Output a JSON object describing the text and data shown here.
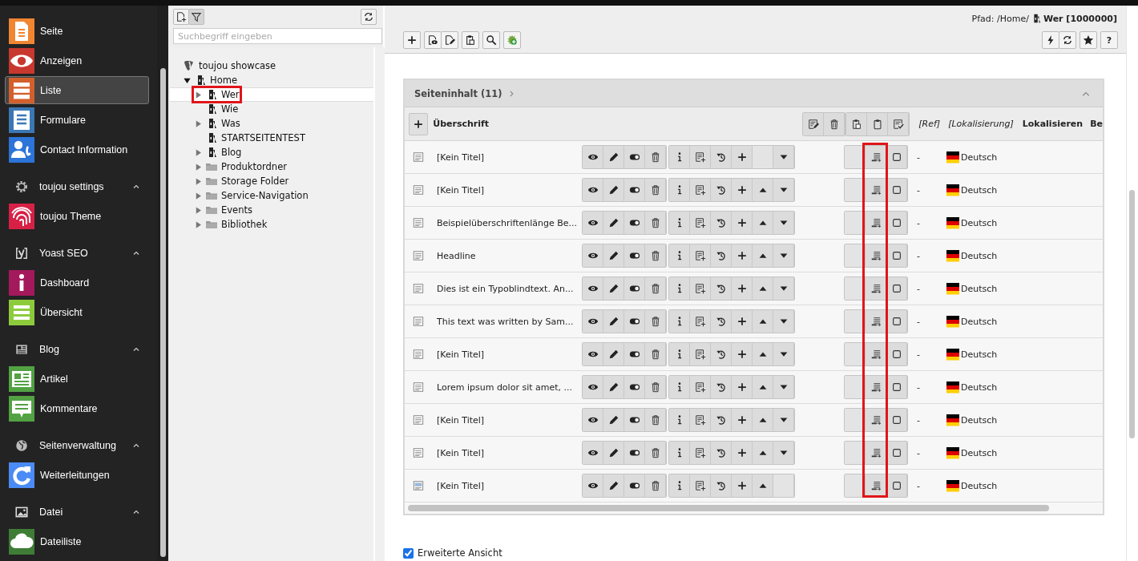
{
  "sidebar": {
    "items": [
      {
        "kind": "module",
        "label": "Seite",
        "color": "#f08532",
        "selected": false
      },
      {
        "kind": "module",
        "label": "Anzeigen",
        "color": "#c8382e",
        "selected": false
      },
      {
        "kind": "module",
        "label": "Liste",
        "color": "#d3602c",
        "selected": true
      },
      {
        "kind": "module",
        "label": "Formulare",
        "color": "#3b77b5",
        "selected": false
      },
      {
        "kind": "module",
        "label": "Contact Information",
        "color": "#2c74d8",
        "selected": false
      },
      {
        "kind": "group",
        "label": "toujou settings",
        "expanded": true
      },
      {
        "kind": "module",
        "label": "toujou Theme",
        "color": "#d72046",
        "selected": false
      },
      {
        "kind": "group",
        "label": "Yoast SEO",
        "expanded": true
      },
      {
        "kind": "module",
        "label": "Dashboard",
        "color": "#a4195c",
        "selected": false
      },
      {
        "kind": "module",
        "label": "Übersicht",
        "color": "#8dcb3d",
        "selected": false
      },
      {
        "kind": "group",
        "label": "Blog",
        "expanded": true
      },
      {
        "kind": "module",
        "label": "Artikel",
        "color": "#52a243",
        "selected": false
      },
      {
        "kind": "module",
        "label": "Kommentare",
        "color": "#52a243",
        "selected": false
      },
      {
        "kind": "group",
        "label": "Seitenverwaltung",
        "expanded": true
      },
      {
        "kind": "module",
        "label": "Weiterleitungen",
        "color": "#4a8bf5",
        "selected": false
      },
      {
        "kind": "group",
        "label": "Datei",
        "expanded": true
      },
      {
        "kind": "module",
        "label": "Dateiliste",
        "color": "#3f7d36",
        "selected": false
      }
    ]
  },
  "page_tree": {
    "filter_active": true,
    "search": {
      "placeholder": "Suchbegriff eingeben"
    },
    "nodes": [
      {
        "label": "toujou showcase",
        "kind": "root",
        "has_children": false,
        "selected": false,
        "highlighted": false,
        "children": [
          {
            "label": "Home",
            "kind": "page",
            "has_children": true,
            "expanded": true,
            "selected": false,
            "highlighted": false,
            "children": [
              {
                "label": "Wer",
                "kind": "page",
                "has_children": true,
                "expanded": false,
                "selected": true,
                "highlighted": true
              },
              {
                "label": "Wie",
                "kind": "page",
                "has_children": false,
                "selected": false,
                "highlighted": false
              },
              {
                "label": "Was",
                "kind": "page",
                "has_children": true,
                "expanded": false,
                "selected": false,
                "highlighted": false
              },
              {
                "label": "STARTSEITENTEST",
                "kind": "page",
                "has_children": false,
                "selected": false,
                "highlighted": false
              },
              {
                "label": "Blog",
                "kind": "page",
                "has_children": true,
                "expanded": false,
                "selected": false,
                "highlighted": false
              },
              {
                "label": "Produktordner",
                "kind": "folder",
                "has_children": true,
                "expanded": false,
                "selected": false,
                "highlighted": false
              },
              {
                "label": "Storage Folder",
                "kind": "folder",
                "has_children": true,
                "expanded": false,
                "selected": false,
                "highlighted": false
              },
              {
                "label": "Service-Navigation",
                "kind": "folder",
                "has_children": true,
                "expanded": false,
                "selected": false,
                "highlighted": false
              },
              {
                "label": "Events",
                "kind": "folder",
                "has_children": true,
                "expanded": false,
                "selected": false,
                "highlighted": false
              },
              {
                "label": "Bibliothek",
                "kind": "folder",
                "has_children": true,
                "expanded": false,
                "selected": false,
                "highlighted": false
              }
            ]
          }
        ]
      }
    ]
  },
  "docheader": {
    "path_prefix": "Pfad: /Home/",
    "path_page": "Wer [1000000]",
    "help_label": "?"
  },
  "panel": {
    "title": "Seiteninhalt (11)",
    "expanded": true,
    "column_highlight": true,
    "columns": [
      {
        "label": "Überschrift",
        "kind": "heading"
      },
      {
        "label": "[Ref]",
        "kind": "note"
      },
      {
        "label": "[Lokalisierung]",
        "kind": "note"
      },
      {
        "label": "Lokalisieren",
        "kind": "heading"
      },
      {
        "label": "Be",
        "kind": "heading"
      }
    ],
    "rows": [
      {
        "kind": "text",
        "title": "[Kein Titel]",
        "move_up": false,
        "move_down": true,
        "checked": false,
        "ref": "-",
        "language": "Deutsch"
      },
      {
        "kind": "text",
        "title": "[Kein Titel]",
        "move_up": true,
        "move_down": true,
        "checked": false,
        "ref": "-",
        "language": "Deutsch"
      },
      {
        "kind": "text",
        "title": "Beispielüberschriftenlänge Be...",
        "move_up": true,
        "move_down": true,
        "checked": false,
        "ref": "-",
        "language": "Deutsch"
      },
      {
        "kind": "text",
        "title": "Headline",
        "move_up": true,
        "move_down": true,
        "checked": false,
        "ref": "-",
        "language": "Deutsch"
      },
      {
        "kind": "text",
        "title": "Dies ist ein Typoblindtext. An...",
        "move_up": true,
        "move_down": true,
        "checked": false,
        "ref": "-",
        "language": "Deutsch"
      },
      {
        "kind": "text",
        "title": "This text was written by Sam...",
        "move_up": true,
        "move_down": true,
        "checked": false,
        "ref": "-",
        "language": "Deutsch"
      },
      {
        "kind": "text",
        "title": "[Kein Titel]",
        "move_up": true,
        "move_down": true,
        "checked": false,
        "ref": "-",
        "language": "Deutsch"
      },
      {
        "kind": "text",
        "title": "Lorem ipsum dolor sit amet, ...",
        "move_up": true,
        "move_down": true,
        "checked": false,
        "ref": "-",
        "language": "Deutsch"
      },
      {
        "kind": "text",
        "title": "[Kein Titel]",
        "move_up": true,
        "move_down": true,
        "checked": false,
        "ref": "-",
        "language": "Deutsch"
      },
      {
        "kind": "text",
        "title": "[Kein Titel]",
        "move_up": true,
        "move_down": true,
        "checked": false,
        "ref": "-",
        "language": "Deutsch"
      },
      {
        "kind": "image",
        "title": "[Kein Titel]",
        "move_up": true,
        "move_down": false,
        "checked": false,
        "ref": "-",
        "language": "Deutsch"
      }
    ]
  },
  "options": [
    {
      "label": "Erweiterte Ansicht",
      "checked": true
    }
  ]
}
